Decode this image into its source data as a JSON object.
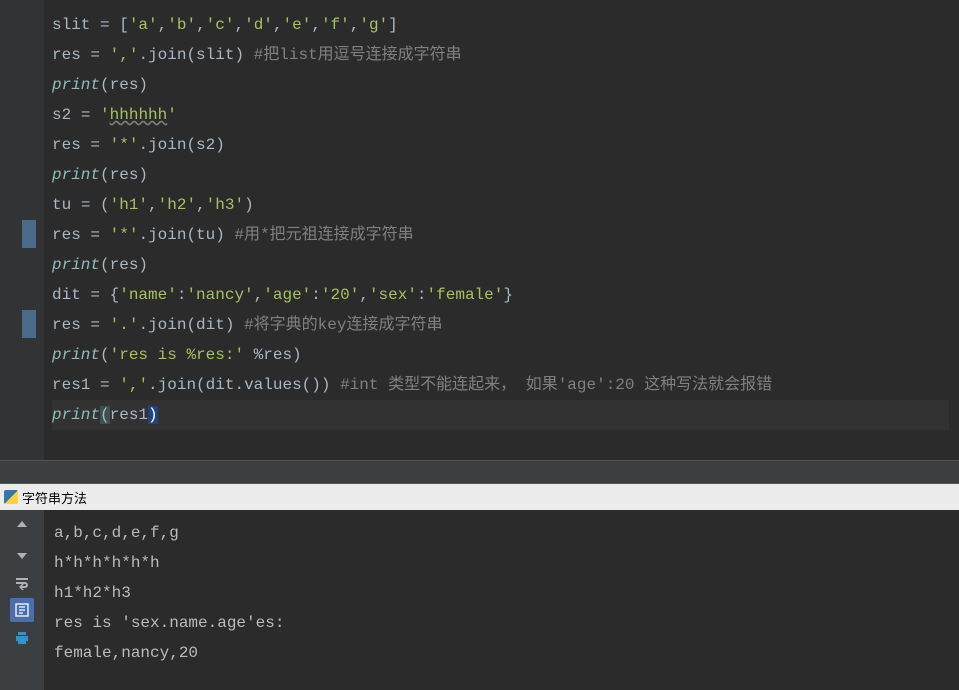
{
  "code": {
    "l1": {
      "a": "slit ",
      "b": "=",
      "c": " [",
      "d": "'a'",
      "e": ",",
      "f": "'b'",
      "g": ",",
      "h": "'c'",
      "i": ",",
      "j": "'d'",
      "k": ",",
      "l": "'e'",
      "m": ",",
      "n": "'f'",
      "o": ",",
      "p": "'g'",
      "q": "]"
    },
    "l2": {
      "a": "res ",
      "b": "=",
      "c": " ",
      "d": "','",
      "e": ".join(slit) ",
      "f": "#把list用逗号连接成字符串"
    },
    "l3": {
      "a": "print",
      "b": "(res)"
    },
    "l4": {
      "a": "s2 ",
      "b": "=",
      "c": " ",
      "d": "'",
      "e": "hhhhhh",
      "f": "'"
    },
    "l5": {
      "a": "res ",
      "b": "=",
      "c": " ",
      "d": "'*'",
      "e": ".join(s2)"
    },
    "l6": {
      "a": "print",
      "b": "(res)"
    },
    "l7": {
      "a": "tu ",
      "b": "=",
      "c": " (",
      "d": "'h1'",
      "e": ",",
      "f": "'h2'",
      "g": ",",
      "h": "'h3'",
      "i": ")"
    },
    "l8": {
      "a": "res ",
      "b": "=",
      "c": " ",
      "d": "'*'",
      "e": ".join(tu) ",
      "f": "#用*把元祖连接成字符串"
    },
    "l9": {
      "a": "print",
      "b": "(res)"
    },
    "l10": {
      "a": "dit ",
      "b": "=",
      "c": " {",
      "d": "'name'",
      "e": ":",
      "f": "'nancy'",
      "g": ",",
      "h": "'age'",
      "i": ":",
      "j": "'20'",
      "k": ",",
      "l": "'sex'",
      "m": ":",
      "n": "'female'",
      "o": "}"
    },
    "l11": {
      "a": "res ",
      "b": "=",
      "c": " ",
      "d": "'.'",
      "e": ".join(dit) ",
      "f": "#将字典的key连接成字符串"
    },
    "l12": {
      "a": "print",
      "b": "(",
      "c": "'res is %res:'",
      "d": " %res)"
    },
    "l13": {
      "a": "res1 ",
      "b": "=",
      "c": " ",
      "d": "','",
      "e": ".join(dit.values()) ",
      "f": "#int 类型不能连起来， 如果'age':20 这种写法就会报错"
    },
    "l14": {
      "a": "print",
      "b": "(",
      "c": "res1",
      "d": ")"
    }
  },
  "output_title": "字符串方法",
  "output": {
    "r1": "a,b,c,d,e,f,g",
    "r2": "h*h*h*h*h*h",
    "r3": "h1*h2*h3",
    "r4": "res is 'sex.name.age'es:",
    "r5": "female,nancy,20"
  }
}
